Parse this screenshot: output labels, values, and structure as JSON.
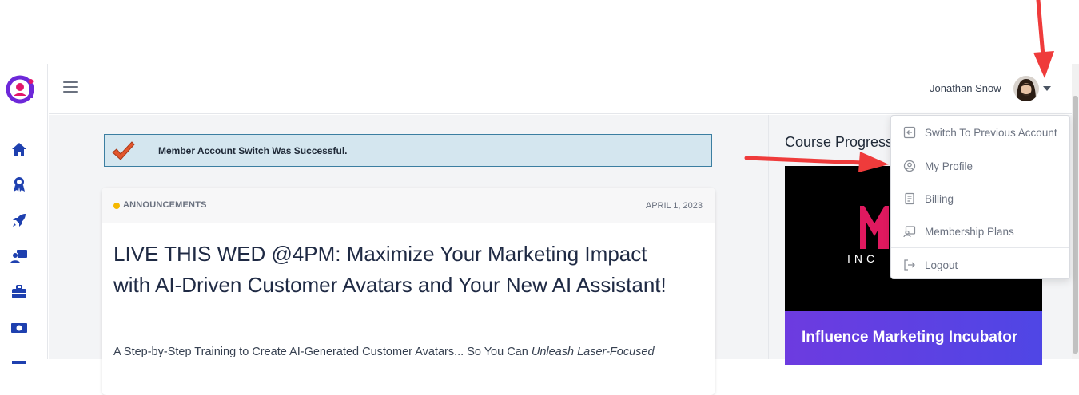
{
  "header": {
    "user_name": "Jonathan Snow"
  },
  "sidebar": {
    "items": [
      {
        "icon": "home-icon"
      },
      {
        "icon": "award-icon"
      },
      {
        "icon": "rocket-icon"
      },
      {
        "icon": "user-screen-icon"
      },
      {
        "icon": "briefcase-icon"
      },
      {
        "icon": "money-icon"
      }
    ]
  },
  "alert": {
    "message": "Member Account Switch Was Successful."
  },
  "post": {
    "category": "ANNOUNCEMENTS",
    "date": "APRIL 1, 2023",
    "title": "LIVE THIS WED @4PM: Maximize Your Marketing Impact with AI-Driven Customer Avatars and Your New AI Assistant!",
    "excerpt_plain": "A Step-by-Step Training to Create AI-Generated Customer Avatars... So You Can ",
    "excerpt_italic": "Unleash Laser-Focused"
  },
  "course": {
    "heading": "Course Progress",
    "logo_sub": "INC",
    "title": "Influence Marketing Incubator"
  },
  "dropdown": {
    "items": [
      {
        "label": "Switch To Previous Account",
        "icon": "switch-account-icon"
      },
      {
        "label": "My Profile",
        "icon": "profile-icon"
      },
      {
        "label": "Billing",
        "icon": "billing-icon"
      },
      {
        "label": "Membership Plans",
        "icon": "membership-icon"
      },
      {
        "label": "Logout",
        "icon": "logout-icon"
      }
    ]
  },
  "colors": {
    "brand_purple": "#6d28d9",
    "brand_pink": "#e2156b",
    "nav_blue": "#1e40af",
    "arrow_red": "#ef3b3b",
    "alert_bg": "#d4e6ef",
    "banner_purple": "#6d3be0"
  }
}
